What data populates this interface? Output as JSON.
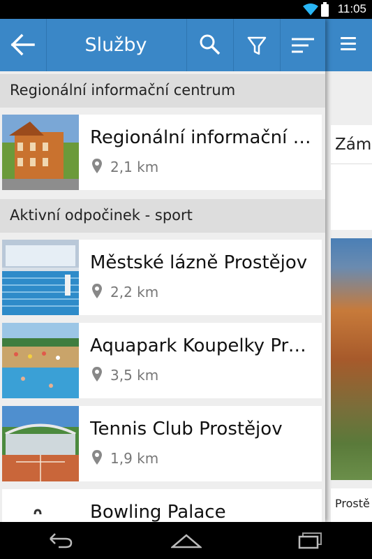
{
  "status": {
    "time": "11:05"
  },
  "appbar": {
    "title": "Služby"
  },
  "sections": [
    {
      "title": "Regionální informační centrum"
    },
    {
      "title": "Aktivní odpočinek - sport"
    }
  ],
  "items": [
    {
      "name": "Regionální informační centrum",
      "distance": "2,1 km"
    },
    {
      "name": "Městské lázně Prostějov",
      "distance": "2,2 km"
    },
    {
      "name": "Aquapark Koupelky Prostějov",
      "distance": "3,5 km"
    },
    {
      "name": "Tennis Club Prostějov",
      "distance": "1,9 km"
    },
    {
      "name": "Bowling Palace",
      "distance": ""
    }
  ],
  "rightpanel": {
    "card_title": "Zám",
    "card_text": "Prostě"
  },
  "colors": {
    "accent": "#3a87c7",
    "section_bg": "#dddddd"
  }
}
